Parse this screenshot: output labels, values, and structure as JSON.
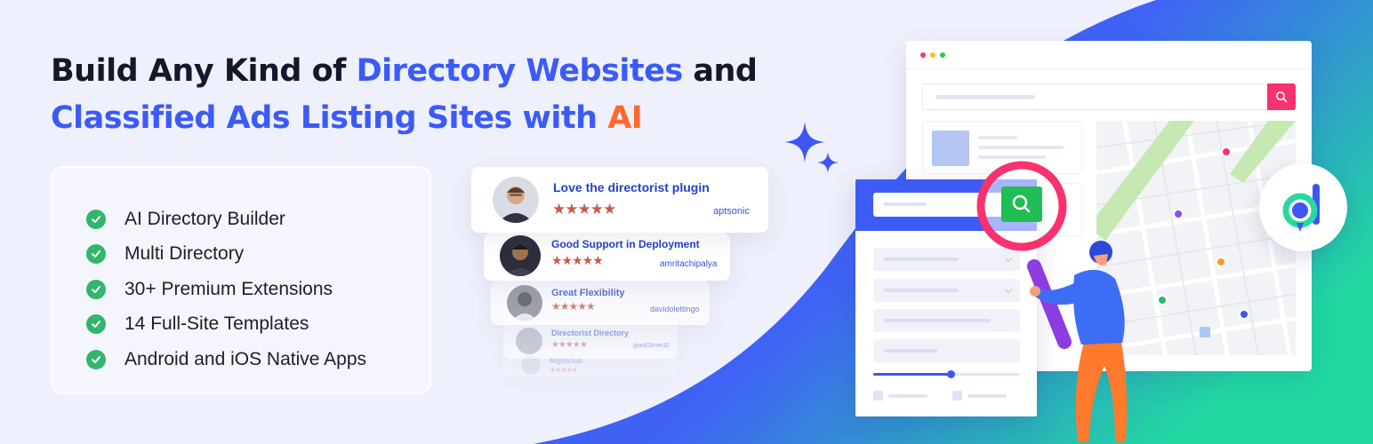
{
  "headline": {
    "line1_pre": "Build Any Kind of ",
    "line1_highlight": "Directory Websites",
    "line1_post": " and",
    "line2_highlight": "Classified Ads Listing Sites with ",
    "line2_ai": "AI"
  },
  "features": [
    "AI Directory Builder",
    "Multi Directory",
    "30+ Premium Extensions",
    "14 Full-Site Templates",
    "Android and iOS Native Apps"
  ],
  "reviews": [
    {
      "title": "Love the directorist plugin",
      "stars": "★★★★★",
      "author": "aptsonic"
    },
    {
      "title": "Good Support in Deployment",
      "stars": "★★★★★",
      "author": "amritachipalya"
    },
    {
      "title": "Great Flexibility",
      "stars": "★★★★★",
      "author": "davidolettingo"
    },
    {
      "title": "Directorist Directory",
      "stars": "★★★★★",
      "author": "good2bme32"
    },
    {
      "title": "Nightclub",
      "stars": "★★★★★",
      "author": ""
    }
  ],
  "colors": {
    "accent_blue": "#3b5af7",
    "ai_orange": "#ff6a2c",
    "check_green": "#31b66b",
    "search_pink": "#f8326e",
    "wave_gradient": [
      "#3a5cf5",
      "#2ad7a0"
    ]
  },
  "icons": {
    "feature_check": "check-circle-icon",
    "search": "search-icon",
    "brand_logo": "directorist-logo-icon",
    "sparkle": "sparkle-icon"
  }
}
